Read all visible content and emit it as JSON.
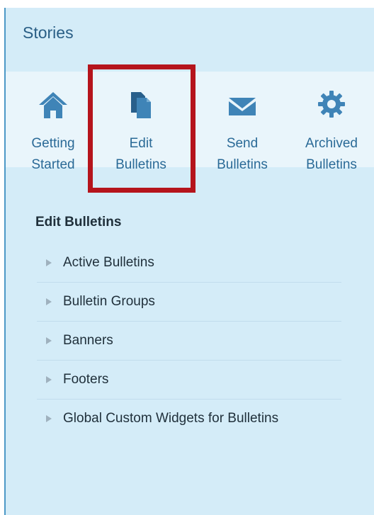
{
  "panel": {
    "title": "Stories"
  },
  "tabs": [
    {
      "line1": "Getting",
      "line2": "Started",
      "icon": "home-icon"
    },
    {
      "line1": "Edit",
      "line2": "Bulletins",
      "icon": "documents-icon",
      "selected": true
    },
    {
      "line1": "Send",
      "line2": "Bulletins",
      "icon": "envelope-icon"
    },
    {
      "line1": "Archived",
      "line2": "Bulletins",
      "icon": "gear-icon"
    }
  ],
  "section": {
    "title": "Edit Bulletins"
  },
  "menu": [
    "Active Bulletins",
    "Bulletin Groups",
    "Banners",
    "Footers",
    "Global Custom Widgets for Bulletins"
  ],
  "colors": {
    "panel_background": "#d4ecf8",
    "tabbar_background": "#e9f5fb",
    "accent_blue": "#2a6a97",
    "highlight_red": "#b5141c"
  }
}
